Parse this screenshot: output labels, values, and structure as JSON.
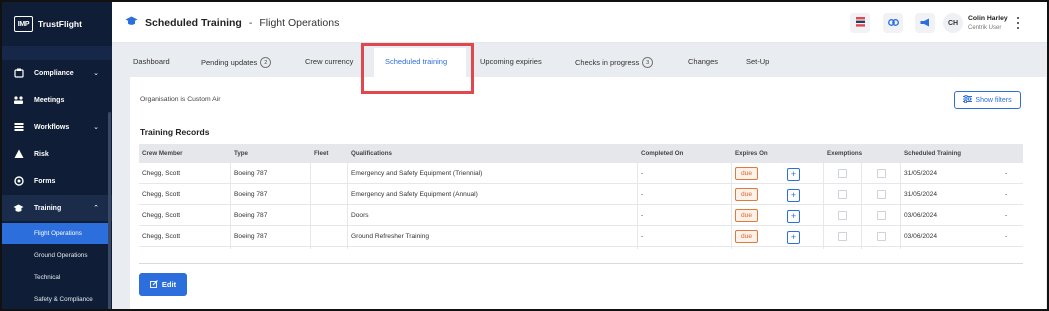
{
  "brand": {
    "logo": "IMP",
    "name": "TrustFlight"
  },
  "sidebar": {
    "items": [
      {
        "label": "Compliance",
        "icon": "compliance-icon",
        "chevron": "⌄"
      },
      {
        "label": "Meetings",
        "icon": "meetings-icon",
        "chevron": ""
      },
      {
        "label": "Workflows",
        "icon": "workflows-icon",
        "chevron": "⌄"
      },
      {
        "label": "Risk",
        "icon": "risk-icon",
        "chevron": ""
      },
      {
        "label": "Forms",
        "icon": "forms-icon",
        "chevron": ""
      },
      {
        "label": "Training",
        "icon": "training-icon",
        "chevron": "⌃"
      }
    ],
    "sub_items": [
      "Flight Operations",
      "Ground Operations",
      "Technical",
      "Safety & Compliance"
    ],
    "active_sub": "Flight Operations"
  },
  "header": {
    "title": "Scheduled Training",
    "separator": "-",
    "subtitle": "Flight Operations",
    "user": {
      "initials": "CH",
      "name": "Colin Harley",
      "role": "Centrik User"
    }
  },
  "tabs": [
    {
      "label": "Dashboard",
      "count": ""
    },
    {
      "label": "Pending updates",
      "count": "2"
    },
    {
      "label": "Crew currency",
      "count": ""
    },
    {
      "label": "Scheduled training",
      "count": "",
      "active": true
    },
    {
      "label": "Upcoming expiries",
      "count": ""
    },
    {
      "label": "Checks in progress",
      "count": "3"
    },
    {
      "label": "Changes",
      "count": ""
    },
    {
      "label": "Set-Up",
      "count": ""
    }
  ],
  "panel": {
    "org_text": "Organisation is Custom Air",
    "filters_label": "Show filters",
    "section_title": "Training Records",
    "edit_label": "Edit"
  },
  "table": {
    "headers": [
      "Crew Member",
      "Type",
      "Fleet",
      "Qualifications",
      "Completed On",
      "Expires On",
      "Exemptions",
      "Scheduled Training"
    ],
    "rows": [
      {
        "crew": "Chegg, Scott",
        "type": "Boeing 787",
        "fleet": "",
        "qualification": "Emergency and Safety Equipment (Triennial)",
        "completed": "-",
        "expires": "due",
        "scheduled": "31/05/2024",
        "extra": "-"
      },
      {
        "crew": "Chegg, Scott",
        "type": "Boeing 787",
        "fleet": "",
        "qualification": "Emergency and Safety Equipment (Annual)",
        "completed": "-",
        "expires": "due",
        "scheduled": "31/05/2024",
        "extra": "-"
      },
      {
        "crew": "Chegg, Scott",
        "type": "Boeing 787",
        "fleet": "",
        "qualification": "Doors",
        "completed": "-",
        "expires": "due",
        "scheduled": "03/06/2024",
        "extra": "-"
      },
      {
        "crew": "Chegg, Scott",
        "type": "Boeing 787",
        "fleet": "",
        "qualification": "Ground Refresher Training",
        "completed": "-",
        "expires": "due",
        "scheduled": "03/06/2024",
        "extra": "-"
      }
    ]
  },
  "colors": {
    "sidebar_bg": "#0f1e36",
    "accent": "#2c6fdc",
    "due": "#e0632c",
    "highlight": "#e0484d"
  }
}
